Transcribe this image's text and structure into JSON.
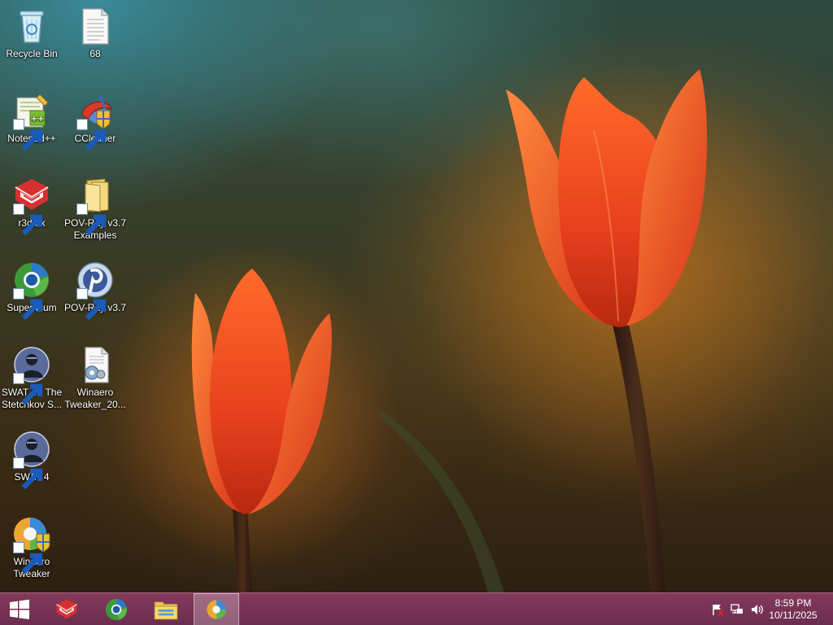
{
  "desktop": {
    "icons": [
      {
        "label": "Recycle Bin",
        "icon": "recycle-bin-icon"
      },
      {
        "label": "68",
        "icon": "text-document-icon"
      },
      {
        "label": "Notepad++",
        "icon": "notepad-plus-plus-icon"
      },
      {
        "label": "CCleaner",
        "icon": "ccleaner-icon"
      },
      {
        "label": "r3dfox",
        "icon": "r3dfox-icon"
      },
      {
        "label": "POV-Ray v3.7\nExamples",
        "icon": "folder-icon"
      },
      {
        "label": "Supermium",
        "icon": "supermium-icon"
      },
      {
        "label": "POV-Ray v3.7",
        "icon": "povray-icon"
      },
      {
        "label": "SWAT 4 - The\nStetchkov S...",
        "icon": "swat4-icon"
      },
      {
        "label": "Winaero\nTweaker_20...",
        "icon": "settings-file-icon"
      },
      {
        "label": "SWAT 4",
        "icon": "swat4-icon"
      },
      {
        "label": "Winaero\nTweaker",
        "icon": "winaero-tweaker-icon"
      }
    ]
  },
  "taskbar": {
    "start": "windows-logo-icon",
    "pinned": [
      {
        "icon": "r3dfox-icon",
        "active": false
      },
      {
        "icon": "supermium-icon",
        "active": false
      },
      {
        "icon": "file-explorer-icon",
        "active": false
      },
      {
        "icon": "winaero-tweaker-icon",
        "active": true
      }
    ],
    "tray": [
      "action-center-flag-icon",
      "network-icon",
      "volume-icon"
    ],
    "clock": {
      "time": "8:59 PM",
      "date": "10/11/2025"
    }
  },
  "colors": {
    "taskbar": "#8c3c64",
    "petal": "#e8401e",
    "petal_light": "#ff7a3a"
  }
}
